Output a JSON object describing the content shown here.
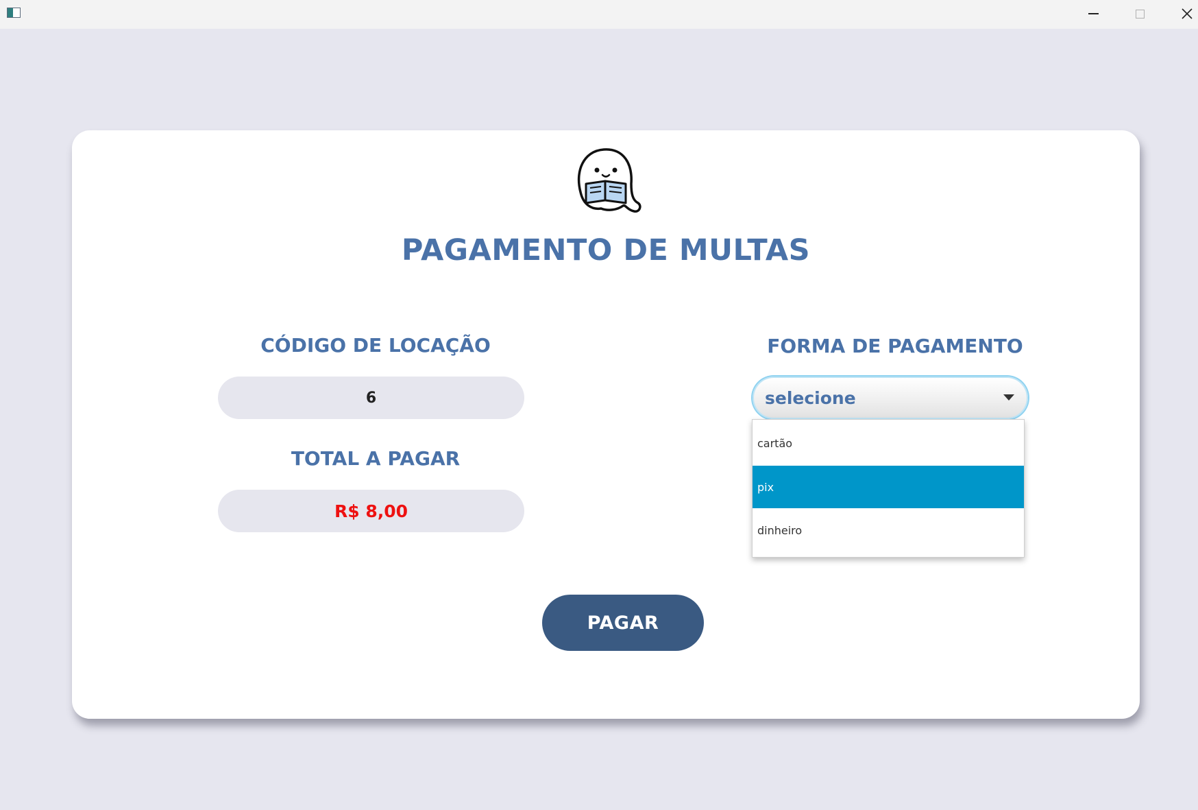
{
  "window": {
    "controls": {
      "minimize_icon": "minimize-icon",
      "maximize_icon": "maximize-icon",
      "close_icon": "close-icon"
    }
  },
  "header": {
    "logo_icon": "ghost-reading-book-icon",
    "title": "PAGAMENTO DE MULTAS"
  },
  "form": {
    "codigo_label": "CÓDIGO DE LOCAÇÃO",
    "codigo_value": "6",
    "total_label": "TOTAL A PAGAR",
    "total_value": "R$ 8,00",
    "forma_label": "FORMA DE PAGAMENTO",
    "forma_selected": "selecione",
    "forma_options": [
      "cartão",
      "pix",
      "dinheiro"
    ],
    "forma_highlighted": "pix"
  },
  "actions": {
    "pay_label": "PAGAR"
  },
  "colors": {
    "background": "#e6e6ef",
    "accent": "#4a72a8",
    "button": "#3a5a82",
    "highlight": "#0096c9",
    "total_text": "#ee1111"
  }
}
